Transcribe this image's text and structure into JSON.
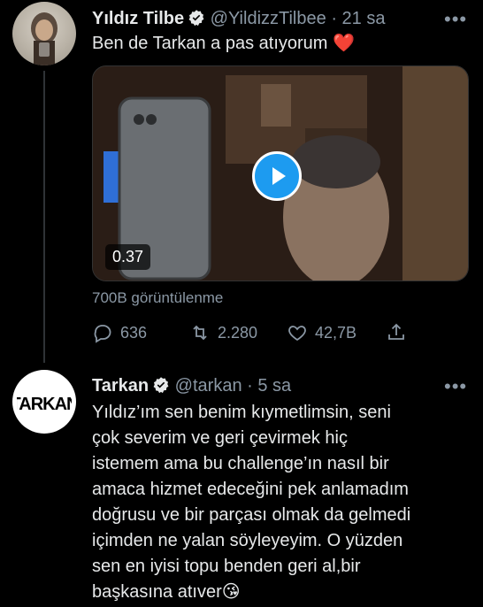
{
  "tweet1": {
    "name": "Yıldız Tilbe",
    "handle": "@YildizzTilbee",
    "dot": "·",
    "time": "21 sa",
    "more": "•••",
    "text": "Ben de Tarkan a pas atıyorum",
    "emoji": "❤️",
    "video_duration": "0.37",
    "views": "700B görüntülenme",
    "replies": "636",
    "retweets": "2.280",
    "likes": "42,7B"
  },
  "tweet2": {
    "name": "Tarkan",
    "handle": "@tarkan",
    "dot": "·",
    "time": "5 sa",
    "more": "•••",
    "lines": [
      "Yıldız’ım sen benim kıymetlimsin, seni",
      "çok severim ve geri çevirmek hiç",
      "istemem ama bu challenge’ın nasıl bir",
      "amaca hizmet edeceğini pek anlamadım",
      "doğrusu ve bir parçası olmak da gelmedi",
      "içimden ne yalan söyleyeyim. O yüzden",
      "sen en iyisi topu benden geri al,bir"
    ],
    "last_line": "başkasına atıver",
    "emoji": "😘",
    "avatar_logo": "TARKAN"
  },
  "colors": {
    "background": "#000000",
    "accent": "#1d9bf0",
    "muted": "#8b98a5"
  }
}
